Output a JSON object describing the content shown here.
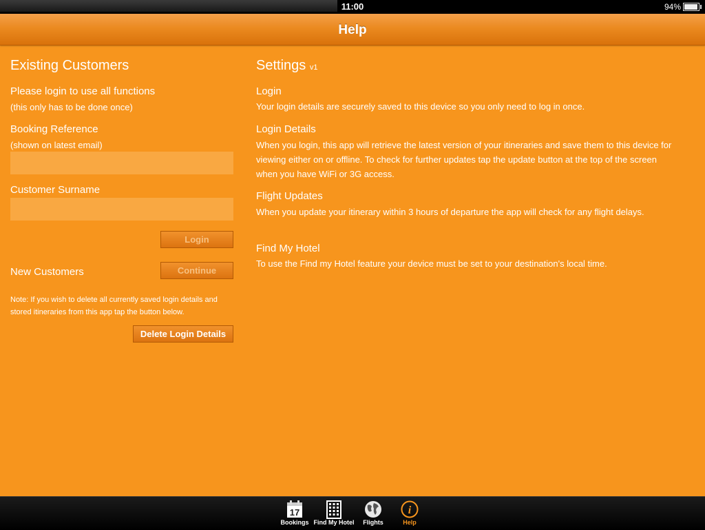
{
  "status_bar": {
    "time": "11:00",
    "battery": "94%",
    "battery_level": 0.94
  },
  "nav": {
    "title": "Help"
  },
  "left": {
    "title": "Existing Customers",
    "login_prompt": "Please login to use all functions",
    "login_prompt_hint": "(this only has to be done once)",
    "booking_ref_label": "Booking Reference",
    "booking_ref_hint": "(shown on latest email)",
    "booking_ref_value": "",
    "surname_label": "Customer Surname",
    "surname_value": "",
    "login_button": "Login",
    "new_customers_label": "New Customers",
    "continue_button": "Continue",
    "note": "Note: If you wish to delete all currently saved login details and stored itineraries from this app tap the button below.",
    "delete_button": "Delete Login Details"
  },
  "settings": {
    "title": "Settings",
    "version": "v1",
    "sections": [
      {
        "heading": "Login",
        "text": "Your login details are securely saved to this device so you only need to log in once."
      },
      {
        "heading": "Login Details",
        "text": "When you login, this app will retrieve the latest version of your itineraries and save them to this device for viewing either on or offline. To check for further updates tap the update button at the top of the screen when you have WiFi or 3G access."
      },
      {
        "heading": "Flight Updates",
        "text": "When you update your itinerary within 3 hours of departure the app will check for any flight delays."
      },
      {
        "heading": "Find My Hotel",
        "text": "To use the Find my Hotel feature your device must be set to your destination's local time."
      }
    ]
  },
  "tabs": [
    {
      "label": "Bookings",
      "icon": "calendar-icon",
      "calendar_day": "17"
    },
    {
      "label": "Find My Hotel",
      "icon": "building-icon"
    },
    {
      "label": "Flights",
      "icon": "globe-icon"
    },
    {
      "label": "Help",
      "icon": "info-icon",
      "active": true
    }
  ],
  "colors": {
    "background": "#f7951d",
    "nav": "#eb8a20",
    "field": "#f9a842",
    "tab_active": "#f7951d"
  }
}
